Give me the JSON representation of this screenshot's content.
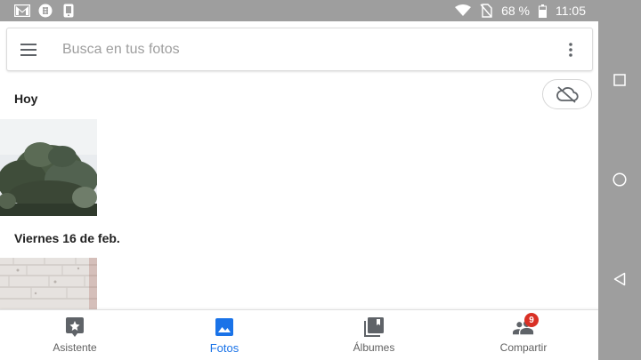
{
  "status_bar": {
    "battery": "68 %",
    "time": "11:05",
    "left_icons": [
      "gmail-icon",
      "slack-icon",
      "phone-icon"
    ],
    "right_icons": [
      "wifi-icon",
      "no-sim-icon",
      "battery-icon"
    ]
  },
  "search": {
    "placeholder": "Busca en tus fotos"
  },
  "sections": [
    {
      "title": "Hoy"
    },
    {
      "title": "Viernes 16 de feb."
    }
  ],
  "bottom_nav": {
    "items": [
      {
        "label": "Asistente",
        "icon": "assistant-icon",
        "active": false
      },
      {
        "label": "Fotos",
        "icon": "photo-icon",
        "active": true
      },
      {
        "label": "Álbumes",
        "icon": "albums-icon",
        "active": false
      },
      {
        "label": "Compartir",
        "icon": "people-icon",
        "active": false,
        "badge": "9"
      }
    ]
  },
  "colors": {
    "accent": "#1a73e8",
    "badge": "#d93025",
    "system_bar": "#9e9e9e"
  }
}
